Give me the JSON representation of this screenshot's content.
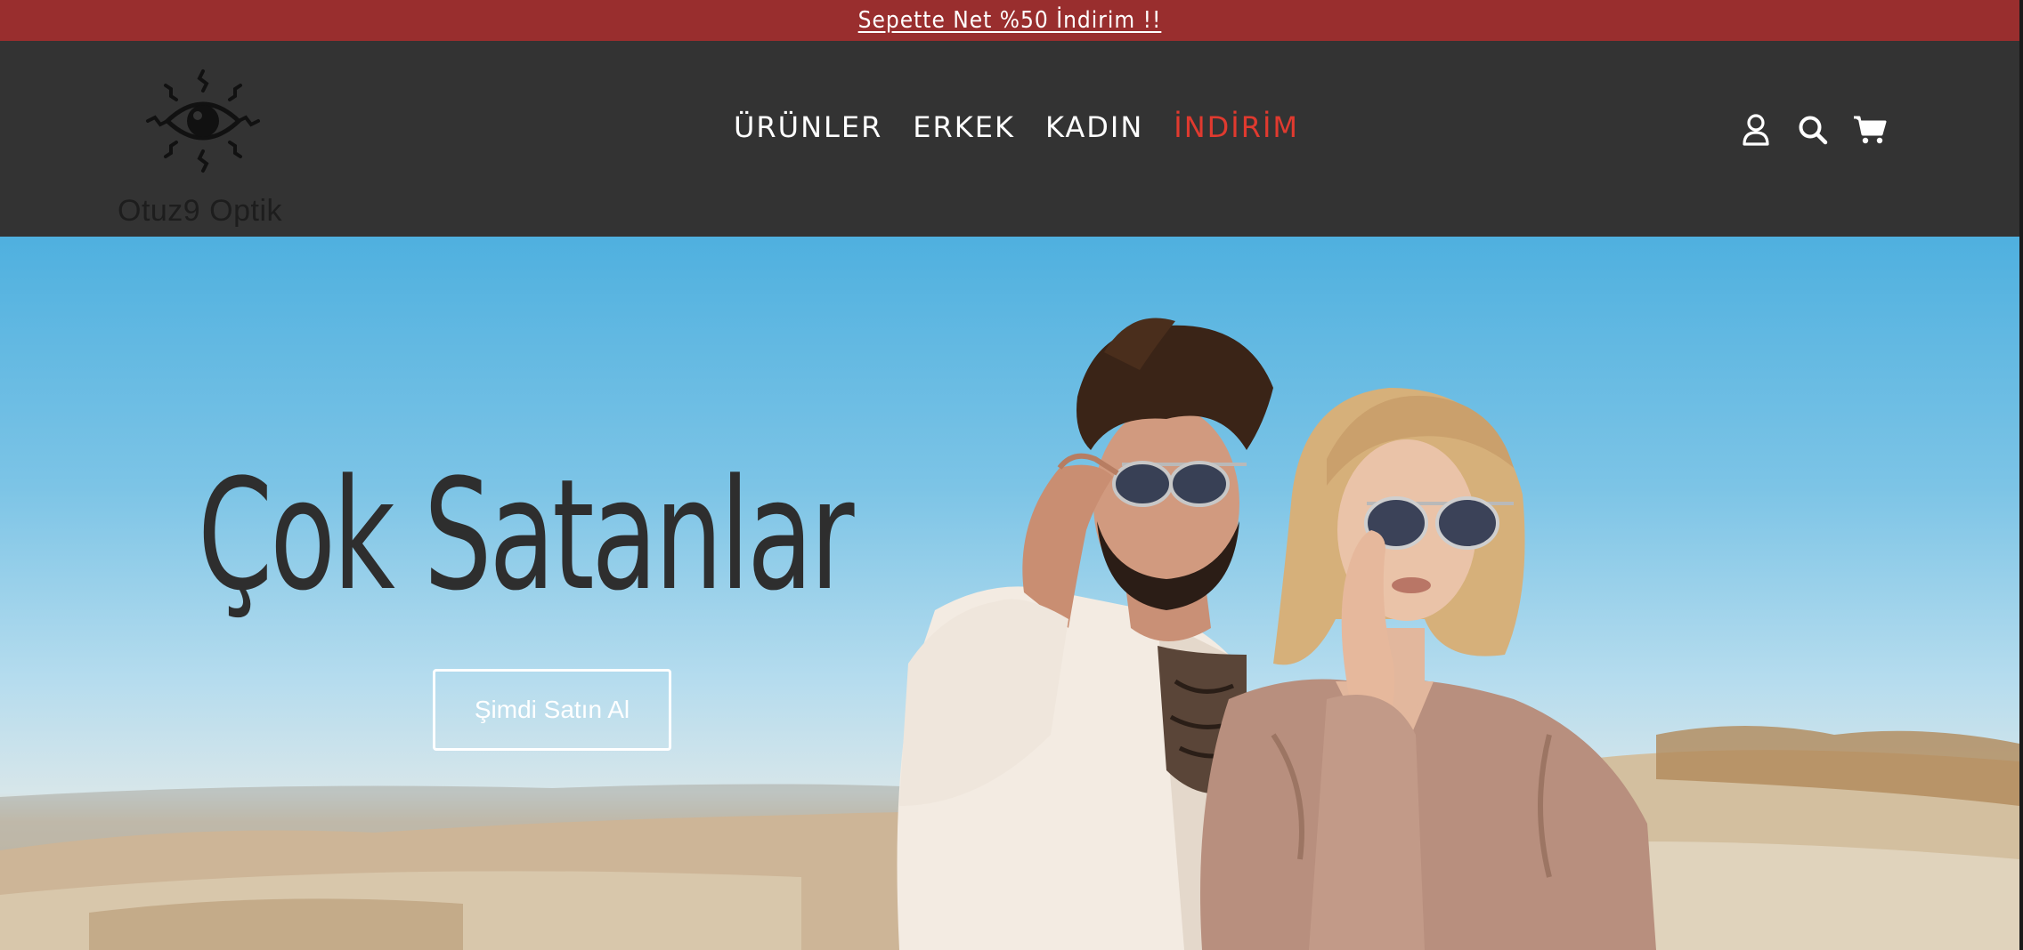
{
  "announcement": {
    "text": "Sepette Net %50 İndirim !!"
  },
  "header": {
    "logo_text": "Otuz9 Optik",
    "logo_icon": "eye-sun-icon",
    "nav": [
      {
        "label": "ÜRÜNLER"
      },
      {
        "label": "ERKEK"
      },
      {
        "label": "KADIN"
      },
      {
        "label": "İNDİRİM"
      }
    ],
    "icons": [
      "account-icon",
      "search-icon",
      "cart-icon"
    ]
  },
  "hero": {
    "title": "Çok Satanlar",
    "button_label": "Şimdi Satın Al",
    "image": "couple-sunglasses-desert-photo"
  },
  "colors": {
    "announcement_bg": "#992e2e",
    "header_bg": "#333333",
    "sale_link": "#e03a2f",
    "hero_title": "#2e2e2e"
  }
}
